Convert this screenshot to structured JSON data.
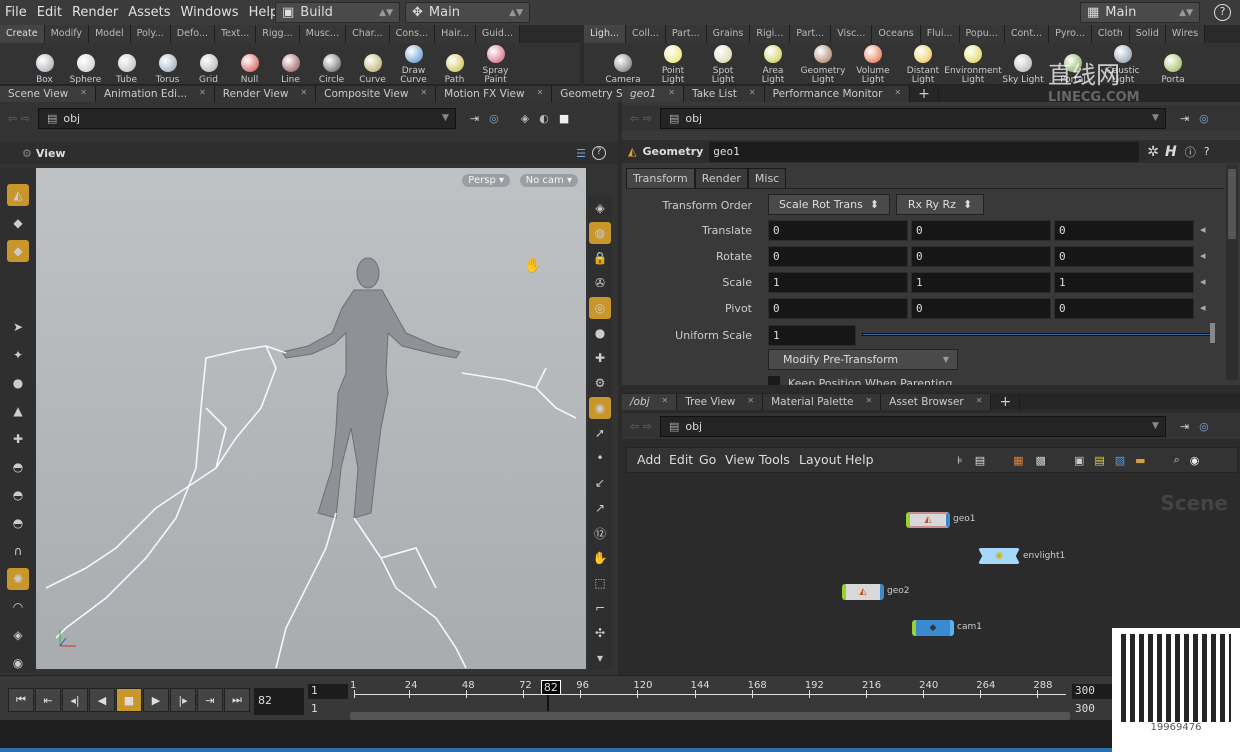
{
  "menu": {
    "items": [
      "File",
      "Edit",
      "Render",
      "Assets",
      "Windows",
      "Help"
    ],
    "desktop": "Build",
    "context": "Main",
    "right_desktop": "Main"
  },
  "shelf_left": {
    "tabs": [
      "Create",
      "Modify",
      "Model",
      "Poly...",
      "Defo...",
      "Text...",
      "Rigg...",
      "Musc...",
      "Char...",
      "Cons...",
      "Hair...",
      "Guid..."
    ],
    "tools": [
      {
        "label": "Box",
        "color": "#9aa3ad"
      },
      {
        "label": "Sphere",
        "color": "#c8c8c8"
      },
      {
        "label": "Tube",
        "color": "#b0b8bb"
      },
      {
        "label": "Torus",
        "color": "#8aa0b5"
      },
      {
        "label": "Grid",
        "color": "#aaaaaa"
      },
      {
        "label": "Null",
        "color": "#d04040"
      },
      {
        "label": "Line",
        "color": "#884444"
      },
      {
        "label": "Circle",
        "color": "#555555"
      },
      {
        "label": "Curve",
        "color": "#b3a05a"
      },
      {
        "label": "Draw Curve",
        "color": "#4a8ac8"
      },
      {
        "label": "Path",
        "color": "#c8b83a"
      },
      {
        "label": "Spray Paint",
        "color": "#d05070"
      }
    ]
  },
  "shelf_right": {
    "tabs": [
      "Ligh...",
      "Coll...",
      "Part...",
      "Grains",
      "Rigi...",
      "Part...",
      "Visc...",
      "Oceans",
      "Flui...",
      "Popu...",
      "Cont...",
      "Pyro...",
      "Cloth",
      "Solid",
      "Wires"
    ],
    "tools": [
      {
        "label": "Camera",
        "color": "#666666"
      },
      {
        "label": "Point Light",
        "color": "#e8e060"
      },
      {
        "label": "Spot Light",
        "color": "#d8d0a0"
      },
      {
        "label": "Area Light",
        "color": "#c8c840"
      },
      {
        "label": "Geometry Light",
        "color": "#a07050"
      },
      {
        "label": "Volume Light",
        "color": "#e06030"
      },
      {
        "label": "Distant Light",
        "color": "#e8c040"
      },
      {
        "label": "Environment Light",
        "color": "#d8d040"
      },
      {
        "label": "Sky Light",
        "color": "#aaaaaa"
      },
      {
        "label": "Portal",
        "color": "#70a040"
      },
      {
        "label": "Caustic Light",
        "color": "#8090a0"
      },
      {
        "label": "Porta",
        "color": "#90b040"
      }
    ]
  },
  "left_pane": {
    "tabs": [
      "Scene View",
      "Animation Edi...",
      "Render View",
      "Composite View",
      "Motion FX View",
      "Geometry Spr..."
    ],
    "path": "obj",
    "view_label": "View",
    "persp": "Persp",
    "cam": "No cam"
  },
  "param_pane": {
    "tabs": [
      "geo1",
      "Take List",
      "Performance Monitor"
    ],
    "path": "obj",
    "node_type": "Geometry",
    "node_name": "geo1",
    "subtabs": [
      "Transform",
      "Render",
      "Misc"
    ],
    "transform_order": {
      "label": "Transform Order",
      "value1": "Scale Rot Trans",
      "value2": "Rx Ry Rz"
    },
    "rows": [
      {
        "label": "Translate",
        "values": [
          "0",
          "0",
          "0"
        ]
      },
      {
        "label": "Rotate",
        "values": [
          "0",
          "0",
          "0"
        ]
      },
      {
        "label": "Scale",
        "values": [
          "1",
          "1",
          "1"
        ]
      },
      {
        "label": "Pivot",
        "values": [
          "0",
          "0",
          "0"
        ]
      }
    ],
    "uniform_scale": {
      "label": "Uniform Scale",
      "value": "1"
    },
    "modify_pretransform": "Modify Pre-Transform",
    "keep_position": "Keep Position When Parenting"
  },
  "network_pane": {
    "tabs": [
      "/obj",
      "Tree View",
      "Material Palette",
      "Asset Browser"
    ],
    "path": "obj",
    "menu": [
      "Add",
      "Edit",
      "Go",
      "View",
      "Tools",
      "Layout",
      "Help"
    ],
    "watermark": "Scene",
    "nodes": [
      {
        "name": "geo1"
      },
      {
        "name": "envlight1"
      },
      {
        "name": "geo2"
      },
      {
        "name": "cam1"
      }
    ]
  },
  "timeline": {
    "current_frame": "82",
    "start": "1",
    "start2": "1",
    "end": "300",
    "end2": "300",
    "ticks": [
      "1",
      "24",
      "48",
      "72",
      "82",
      "96",
      "120",
      "144",
      "168",
      "192",
      "216",
      "240",
      "264",
      "288"
    ]
  },
  "overlay": {
    "watermark_cn": "直线网",
    "watermark_en": "LINECG.COM",
    "qq": "19969476"
  },
  "colors": {
    "accent_orange": "#c8962a",
    "viewport_bg": "#b4b8bc",
    "node_geo": "#d8d8d8",
    "node_cam": "#3a8ad0",
    "node_light": "#9fd0f0"
  }
}
